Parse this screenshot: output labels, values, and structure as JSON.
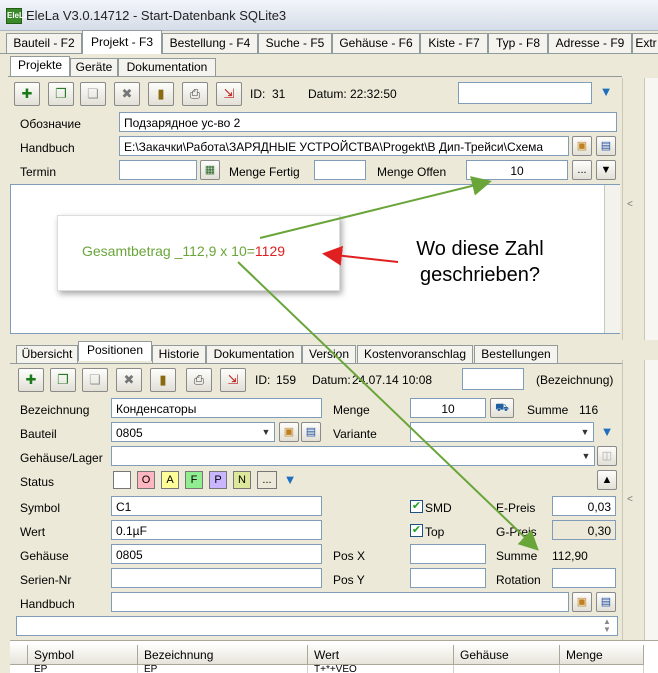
{
  "window": {
    "title": "EleLa V3.0.14712  - Start-Datenbank SQLite3",
    "app_icon": "EleLa"
  },
  "main_tabs": [
    "Bauteil - F2",
    "Projekt - F3",
    "Bestellung - F4",
    "Suche - F5",
    "Gehäuse - F6",
    "Kiste - F7",
    "Typ - F8",
    "Adresse - F9",
    "Extr"
  ],
  "project_tabs": [
    "Projekte",
    "Geräte",
    "Dokumentation"
  ],
  "project": {
    "id_label": "ID:",
    "id": "31",
    "date_label": "Datum:",
    "date": "22:32:50",
    "search_value": "",
    "designation_label": "Обозначие",
    "designation": "Подзарядное ус-во 2",
    "handbook_label": "Handbuch",
    "handbook": "E:\\Закачки\\Работа\\ЗАРЯДНЫЕ  УСТРОЙСТВА\\Progekt\\В Дип-Трейси\\Схема",
    "termin_label": "Termin",
    "termin": "",
    "menge_fertig_label": "Menge Fertig",
    "menge_fertig": "",
    "menge_offen_label": "Menge Offen",
    "menge_offen": "10",
    "more_label": "..."
  },
  "annotation": {
    "callout_prefix": "Gesamtbetrag _112,9 x 10=",
    "callout_result": "1129",
    "question": "Wo diese Zahl geschrieben?"
  },
  "detail_tabs": [
    "Übersicht",
    "Positionen",
    "Historie",
    "Dokumentation",
    "Version",
    "Kostenvoranschlag",
    "Bestellungen"
  ],
  "position": {
    "id_label": "ID:",
    "id": "159",
    "date_label": "Datum:",
    "date": "24.07.14 10:08",
    "bezeichnung_hint": "(Bezeichnung)",
    "bezeichnung_label": "Bezeichnung",
    "bezeichnung": "Конденсаторы",
    "menge_label": "Menge",
    "menge": "10",
    "summe_label": "Summe",
    "summe": "116",
    "bauteil_label": "Bauteil",
    "bauteil": "0805",
    "variante_label": "Variante",
    "variante": "",
    "gehaeuse_lager_label": "Gehäuse/Lager",
    "gehaeuse_lager": "",
    "status_label": "Status",
    "status_buttons": [
      "O",
      "A",
      "F",
      "P",
      "N"
    ],
    "status_colors": [
      "#ffb6c1",
      "#ffff99",
      "#90ee90",
      "#c9b6ff",
      "#dde89a"
    ],
    "symbol_label": "Symbol",
    "symbol": "C1",
    "smd_label": "SMD",
    "smd_checked": true,
    "epreis_label": "E-Preis",
    "epreis": "0,03",
    "wert_label": "Wert",
    "wert": "0.1µF",
    "top_label": "Top",
    "top_checked": true,
    "gpreis_label": "G-Preis",
    "gpreis": "0,30",
    "gehaeuse_label": "Gehäuse",
    "gehaeuse": "0805",
    "posx_label": "Pos X",
    "posx": "",
    "summe2_label": "Summe",
    "summe2": "112,90",
    "seriennr_label": "Serien-Nr",
    "seriennr": "",
    "posy_label": "Pos Y",
    "posy": "",
    "rotation_label": "Rotation",
    "rotation": "",
    "handbuch_label": "Handbuch",
    "handbuch": ""
  },
  "grid": {
    "columns": [
      "Symbol",
      "Bezeichnung",
      "Wert",
      "Gehäuse",
      "Menge"
    ],
    "row1": [
      "EP",
      "EP",
      "T+*+VEO",
      "",
      ""
    ]
  },
  "colors": {
    "callout_green": "#6aa53a",
    "callout_red": "#e02020",
    "arrow_green": "#6aa53a",
    "arrow_red": "#e02020"
  }
}
